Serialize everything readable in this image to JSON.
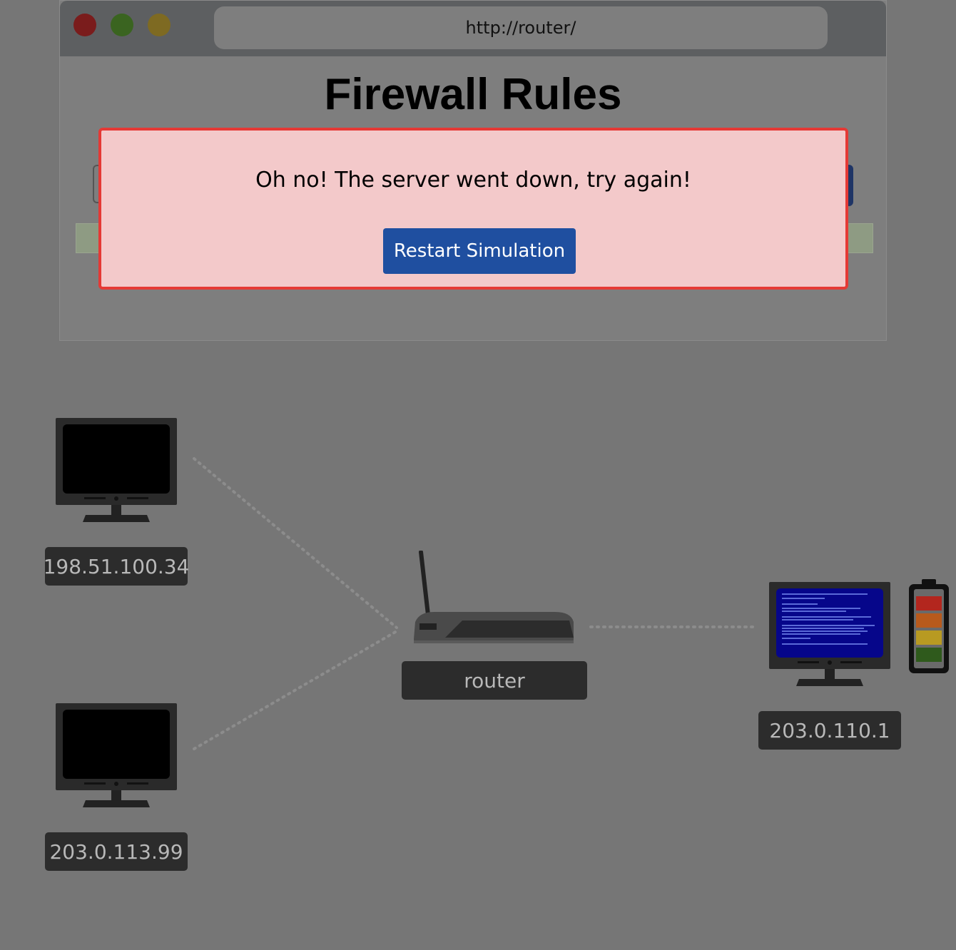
{
  "browser": {
    "url": "http://router/",
    "title": "Firewall Rules"
  },
  "modal": {
    "message": "Oh no! The server went down, try again!",
    "button_label": "Restart Simulation"
  },
  "network": {
    "clients": [
      {
        "ip": "198.51.100.34"
      },
      {
        "ip": "203.0.113.99"
      }
    ],
    "router": {
      "label": "router"
    },
    "server": {
      "ip": "203.0.110.1",
      "status": "crashed"
    }
  },
  "colors": {
    "modal_border": "#e53935",
    "modal_bg": "#f3c9ca",
    "button": "#1f4fa0",
    "battery_levels": [
      "#b3261e",
      "#b85a1c",
      "#b89a22",
      "#2f5a1c"
    ]
  }
}
